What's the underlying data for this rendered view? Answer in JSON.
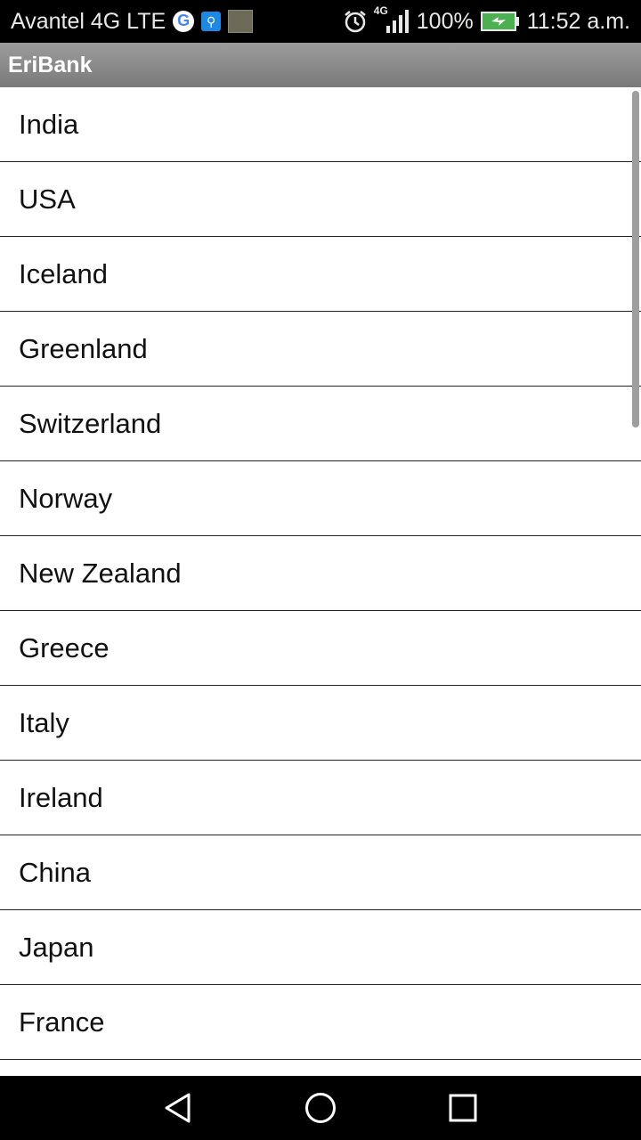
{
  "statusbar": {
    "carrier": "Avantel 4G LTE",
    "network_badge": "4G",
    "battery_percent": "100%",
    "time": "11:52 a.m.",
    "icons": [
      "google-icon",
      "usb-icon",
      "photo-notification-icon",
      "alarm-icon",
      "signal-icon",
      "battery-charging-icon"
    ]
  },
  "app": {
    "title": "EriBank"
  },
  "countries": [
    "India",
    "USA",
    "Iceland",
    "Greenland",
    "Switzerland",
    "Norway",
    "New Zealand",
    "Greece",
    "Italy",
    "Ireland",
    "China",
    "Japan",
    "France"
  ],
  "navbar": {
    "icons": [
      "back-icon",
      "home-icon",
      "recent-apps-icon"
    ]
  },
  "colors": {
    "statusbar_bg": "#000000",
    "titlebar_bg": "#8a8a8a",
    "list_bg": "#ffffff",
    "divider": "#222222"
  }
}
